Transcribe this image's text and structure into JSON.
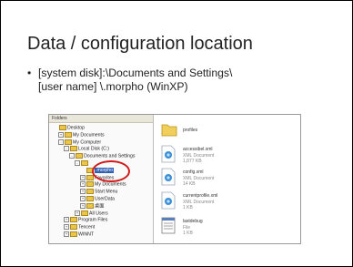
{
  "slide": {
    "title": "Data / configuration location",
    "bullet_line1": "[system disk]:\\Documents and Settings\\",
    "bullet_line2": "[user name] \\.morpho (WinXP)"
  },
  "screenshot": {
    "tree_header": "Folders",
    "tree": [
      {
        "label": "Desktop",
        "pm": "",
        "sel": false
      },
      {
        "label": "My Documents",
        "pm": "+",
        "sel": false
      },
      {
        "label": "My Computer",
        "pm": "-",
        "sel": false
      },
      {
        "label": "Local Disk (C:)",
        "pm": "-",
        "sel": false
      },
      {
        "label": "Documents and Settings",
        "pm": "-",
        "sel": false
      },
      {
        "label": "",
        "pm": "-",
        "sel": false
      },
      {
        "label": ".morpho",
        "pm": "",
        "sel": true
      },
      {
        "label": "Favorites",
        "pm": "+",
        "sel": false
      },
      {
        "label": "My Documents",
        "pm": "+",
        "sel": false
      },
      {
        "label": "Start Menu",
        "pm": "+",
        "sel": false
      },
      {
        "label": "UserData",
        "pm": "+",
        "sel": false
      },
      {
        "label": "桌面",
        "pm": "+",
        "sel": false
      },
      {
        "label": "All Users",
        "pm": "+",
        "sel": false
      },
      {
        "label": "Program Files",
        "pm": "+",
        "sel": false
      },
      {
        "label": "Tencent",
        "pm": "+",
        "sel": false
      },
      {
        "label": "WINNT",
        "pm": "+",
        "sel": false
      }
    ],
    "files": [
      {
        "name": "profiles",
        "sub1": "",
        "icon": "folder-icon"
      },
      {
        "name": "accessibel.xml",
        "sub1": "XML Document",
        "sub2": "1,877 KB",
        "icon": "xml-file-icon"
      },
      {
        "name": "config.xml",
        "sub1": "XML Document",
        "sub2": "14 KB",
        "icon": "xml-file-icon"
      },
      {
        "name": "currentprofile.xml",
        "sub1": "XML Document",
        "sub2": "1 KB",
        "icon": "xml-file-icon"
      },
      {
        "name": "lastdebug",
        "sub1": "File",
        "sub2": "1 KB",
        "icon": "text-file-icon"
      }
    ]
  }
}
